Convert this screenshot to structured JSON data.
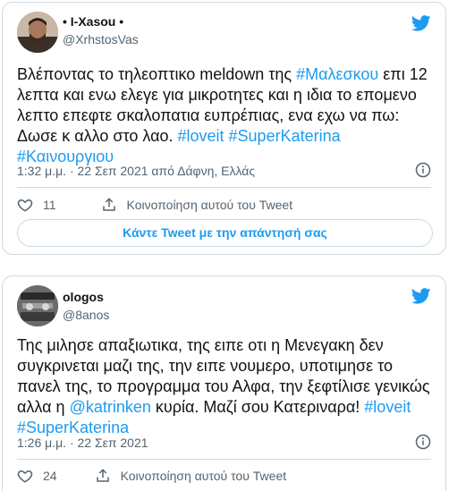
{
  "tweets": [
    {
      "display_name": "• I-Xasou •",
      "handle": "@XrhstosVas",
      "text_parts": [
        {
          "t": "Βλέποντας το τηλεοπτικο meldown της ",
          "link": false
        },
        {
          "t": "#Μαλεσκου",
          "link": true
        },
        {
          "t": " επι 12 λεπτα και ενω ελεγε για μικροτητες και η ιδια το επομενο λεπτο επεφτε σκαλοπατια ευπρέπιας, ενα εχω να πω: Δωσε κ αλλο στο λαο. ",
          "link": false
        },
        {
          "t": "#loveit",
          "link": true
        },
        {
          "t": " ",
          "link": false
        },
        {
          "t": "#SuperKaterina",
          "link": true
        },
        {
          "t": " ",
          "link": false
        },
        {
          "t": "#Καινουργιου",
          "link": true
        }
      ],
      "timestamp": "1:32 μ.μ. · 22 Σεπ 2021 από Δάφνη, Ελλάς",
      "likes": "11",
      "share_label": "Κοινοποίηση αυτού του Tweet",
      "reply_label": "Κάντε Tweet με την απάντησή σας"
    },
    {
      "display_name": "ologos",
      "handle": "@8anos",
      "text_parts": [
        {
          "t": "Της μιλησε απαξιωτικα, της ειπε οτι η Μενεγακη δεν συγκρινεται μαζι της, την ειπε νουμερο, υποτιμησε το πανελ της, το προγραμμα του Αλφα, την ξεφτίλισε γενικώς αλλα η ",
          "link": false
        },
        {
          "t": "@katrinken",
          "link": true
        },
        {
          "t": " κυρία. Μαζί σου Κατεριναρα! ",
          "link": false
        },
        {
          "t": "#loveit",
          "link": true
        },
        {
          "t": " ",
          "link": false
        },
        {
          "t": "#SuperKaterina",
          "link": true
        }
      ],
      "timestamp": "1:26 μ.μ. · 22 Σεπ 2021",
      "likes": "24",
      "share_label": "Κοινοποίηση αυτού του Tweet"
    }
  ],
  "colors": {
    "accent": "#1d9bf0",
    "text": "#0f1419",
    "muted": "#536471",
    "border": "#cfd9de"
  },
  "icons": [
    "twitter-bird-icon",
    "heart-icon",
    "share-icon",
    "info-icon"
  ]
}
